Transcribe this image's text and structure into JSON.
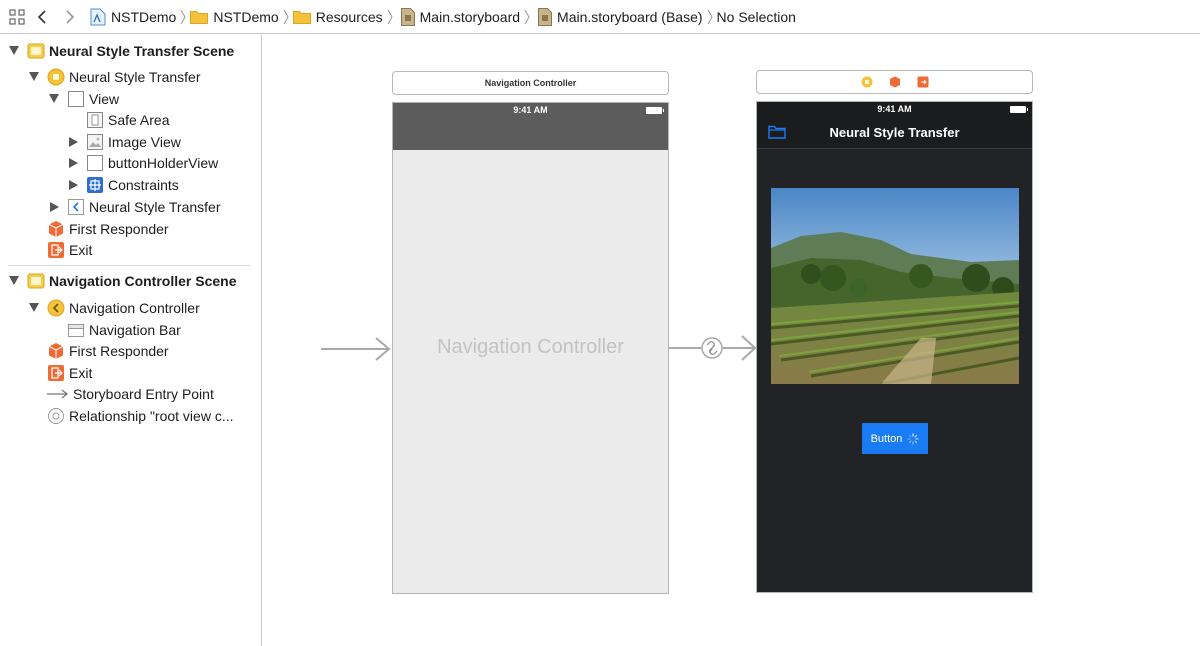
{
  "jumpbar": {
    "crumbs": [
      {
        "label": "NSTDemo",
        "icon": "project-icon"
      },
      {
        "label": "NSTDemo",
        "icon": "folder-icon"
      },
      {
        "label": "Resources",
        "icon": "folder-icon"
      },
      {
        "label": "Main.storyboard",
        "icon": "storyboard-icon"
      },
      {
        "label": "Main.storyboard (Base)",
        "icon": "storyboard-icon"
      },
      {
        "label": "No Selection",
        "icon": ""
      }
    ]
  },
  "outline": {
    "nst_scene": {
      "title": "Neural Style Transfer Scene",
      "controller": "Neural Style Transfer",
      "view": "View",
      "safe_area": "Safe Area",
      "image_view": "Image View",
      "button_holder": "buttonHolderView",
      "constraints": "Constraints",
      "nav_item": "Neural Style Transfer",
      "first_responder": "First Responder",
      "exit": "Exit"
    },
    "nav_scene": {
      "title": "Navigation Controller Scene",
      "controller": "Navigation Controller",
      "nav_bar": "Navigation Bar",
      "first_responder": "First Responder",
      "exit": "Exit",
      "entry_point": "Storyboard Entry Point",
      "relationship": "Relationship \"root view c..."
    }
  },
  "canvas": {
    "nav_controller": {
      "scene_label": "Navigation Controller",
      "status_time": "9:41 AM",
      "placeholder": "Navigation Controller"
    },
    "nst_controller": {
      "status_time": "9:41 AM",
      "nav_title": "Neural Style Transfer",
      "button_label": "Button"
    }
  },
  "colors": {
    "accent": "#1a7cf5",
    "dark_bg": "#222326",
    "nav_gray": "#5b5b5b",
    "placeholder_bg": "#ebebeb",
    "scene_icon_yellow": "#f2c12e",
    "responder_orange": "#ee6b35"
  }
}
